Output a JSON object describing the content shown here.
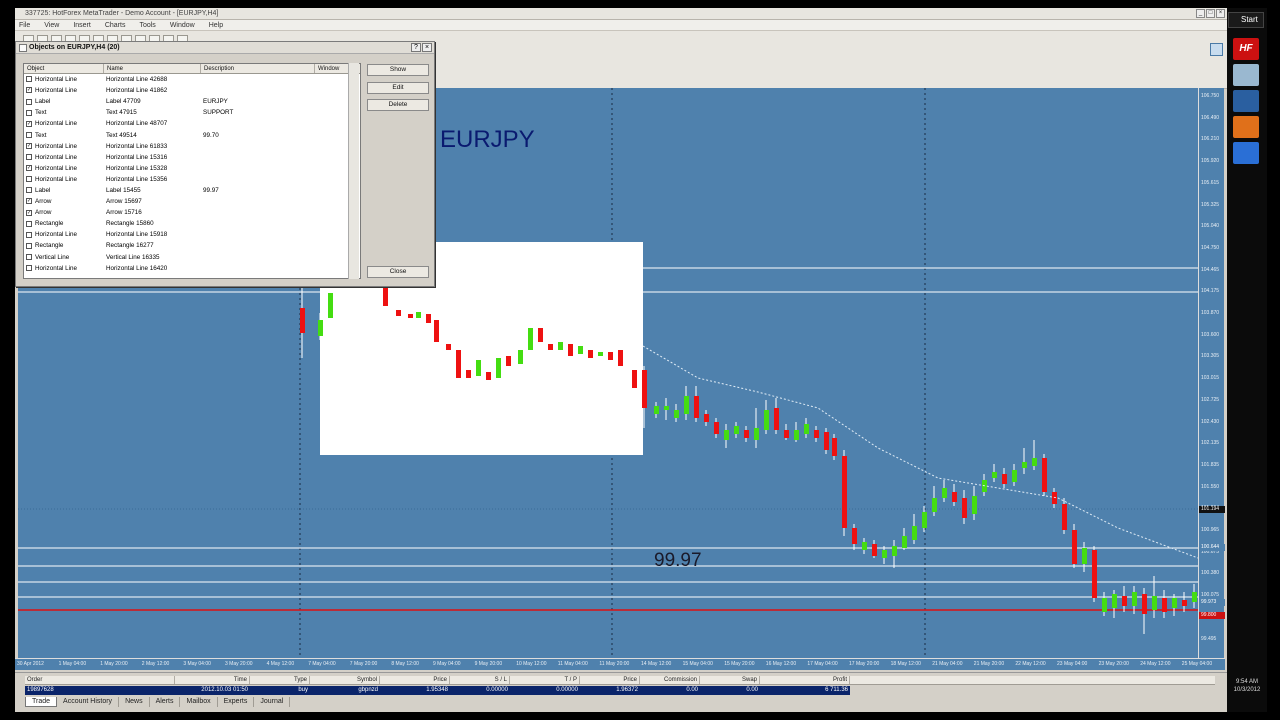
{
  "window": {
    "title": "337725: HotForex MetaTrader - Demo Account - [EURJPY,H4]",
    "menu": [
      "File",
      "View",
      "Insert",
      "Charts",
      "Tools",
      "Window",
      "Help"
    ]
  },
  "dialog": {
    "title": "Objects on EURJPY,H4 (20)",
    "help_label": "?",
    "close_x_label": "×",
    "columns": [
      "Object",
      "Name",
      "Description",
      "Window"
    ],
    "rows": [
      {
        "checked": false,
        "object": "Horizontal Line",
        "name": "Horizontal Line 42688",
        "description": "",
        "window": "0"
      },
      {
        "checked": true,
        "object": "Horizontal Line",
        "name": "Horizontal Line 41862",
        "description": "",
        "window": "0"
      },
      {
        "checked": false,
        "object": "Label",
        "name": "Label 47709",
        "description": "EURJPY",
        "window": "0"
      },
      {
        "checked": false,
        "object": "Text",
        "name": "Text 47915",
        "description": "SUPPORT",
        "window": "0"
      },
      {
        "checked": true,
        "object": "Horizontal Line",
        "name": "Horizontal Line 48707",
        "description": "",
        "window": "0"
      },
      {
        "checked": false,
        "object": "Text",
        "name": "Text 49514",
        "description": "99.70",
        "window": "0"
      },
      {
        "checked": true,
        "object": "Horizontal Line",
        "name": "Horizontal Line 61833",
        "description": "",
        "window": "0"
      },
      {
        "checked": false,
        "object": "Horizontal Line",
        "name": "Horizontal Line 15316",
        "description": "",
        "window": "0"
      },
      {
        "checked": true,
        "object": "Horizontal Line",
        "name": "Horizontal Line 15328",
        "description": "",
        "window": "0"
      },
      {
        "checked": false,
        "object": "Horizontal Line",
        "name": "Horizontal Line 15356",
        "description": "",
        "window": "0"
      },
      {
        "checked": false,
        "object": "Label",
        "name": "Label 15455",
        "description": "99.97",
        "window": "0"
      },
      {
        "checked": true,
        "object": "Arrow",
        "name": "Arrow 15697",
        "description": "",
        "window": "0"
      },
      {
        "checked": true,
        "object": "Arrow",
        "name": "Arrow 15716",
        "description": "",
        "window": "0"
      },
      {
        "checked": false,
        "object": "Rectangle",
        "name": "Rectangle 15860",
        "description": "",
        "window": "0"
      },
      {
        "checked": false,
        "object": "Horizontal Line",
        "name": "Horizontal Line 15918",
        "description": "",
        "window": "0"
      },
      {
        "checked": false,
        "object": "Rectangle",
        "name": "Rectangle 16277",
        "description": "",
        "window": "0"
      },
      {
        "checked": false,
        "object": "Vertical Line",
        "name": "Vertical Line 16335",
        "description": "",
        "window": "0"
      },
      {
        "checked": false,
        "object": "Horizontal Line",
        "name": "Horizontal Line 16420",
        "description": "",
        "window": "0"
      }
    ],
    "buttons": {
      "show": "Show",
      "edit": "Edit",
      "delete": "Delete",
      "close": "Close"
    }
  },
  "chart": {
    "symbol_label": "EURJPY",
    "price_label": "99.97",
    "price_ticks": [
      "106.750",
      "106.490",
      "106.210",
      "105.920",
      "105.615",
      "105.325",
      "105.040",
      "104.750",
      "104.465",
      "104.175",
      "103.870",
      "103.600",
      "103.305",
      "103.015",
      "102.725",
      "102.430",
      "102.135",
      "101.835",
      "101.550",
      "101.264",
      "100.965",
      "100.675",
      "100.380",
      "100.075",
      "99.790",
      "99.495"
    ],
    "price_tags": [
      {
        "text": "101.194",
        "color": "#111111"
      },
      {
        "text": "100.644",
        "color": "#4f81ad"
      },
      {
        "text": "99.973",
        "color": "#4f81ad"
      },
      {
        "text": "99.800",
        "color": "#cc1111"
      }
    ],
    "time_ticks": [
      "30 Apr 2012",
      "1 May 04:00",
      "1 May 20:00",
      "2 May 12:00",
      "3 May 04:00",
      "3 May 20:00",
      "4 May 12:00",
      "7 May 04:00",
      "7 May 20:00",
      "8 May 12:00",
      "9 May 04:00",
      "9 May 20:00",
      "10 May 12:00",
      "11 May 04:00",
      "11 May 20:00",
      "14 May 12:00",
      "15 May 04:00",
      "15 May 20:00",
      "16 May 12:00",
      "17 May 04:00",
      "17 May 20:00",
      "18 May 12:00",
      "21 May 04:00",
      "21 May 20:00",
      "22 May 12:00",
      "23 May 04:00",
      "23 May 20:00",
      "24 May 12:00",
      "25 May 04:00"
    ]
  },
  "terminal": {
    "columns": [
      "Order",
      "Time",
      "Type",
      "Symbol",
      "Price",
      "S / L",
      "T / P",
      "Price",
      "Commission",
      "Swap",
      "Profit"
    ],
    "row": [
      "19897628",
      "2012.10.03 01:50",
      "buy",
      "gbpnzd",
      "1.95348",
      "0.00000",
      "0.00000",
      "1.96372",
      "0.00",
      "0.00",
      "6 711.36"
    ],
    "tabs": [
      "Trade",
      "Account History",
      "News",
      "Alerts",
      "Mailbox",
      "Experts",
      "Journal"
    ]
  },
  "taskbar": {
    "start_label": "Start",
    "time": "9:54 AM",
    "date": "10/3/2012",
    "apps": [
      "hf-icon",
      "window-icon",
      "explorer-icon",
      "firefox-icon",
      "flower-icon"
    ]
  },
  "colors": {
    "chart_bg": "#4f81ad",
    "bull_candle": "#44dd11",
    "bear_candle": "#ee1111",
    "symbol_text": "#0a1a70",
    "selection": "#0a246a"
  }
}
